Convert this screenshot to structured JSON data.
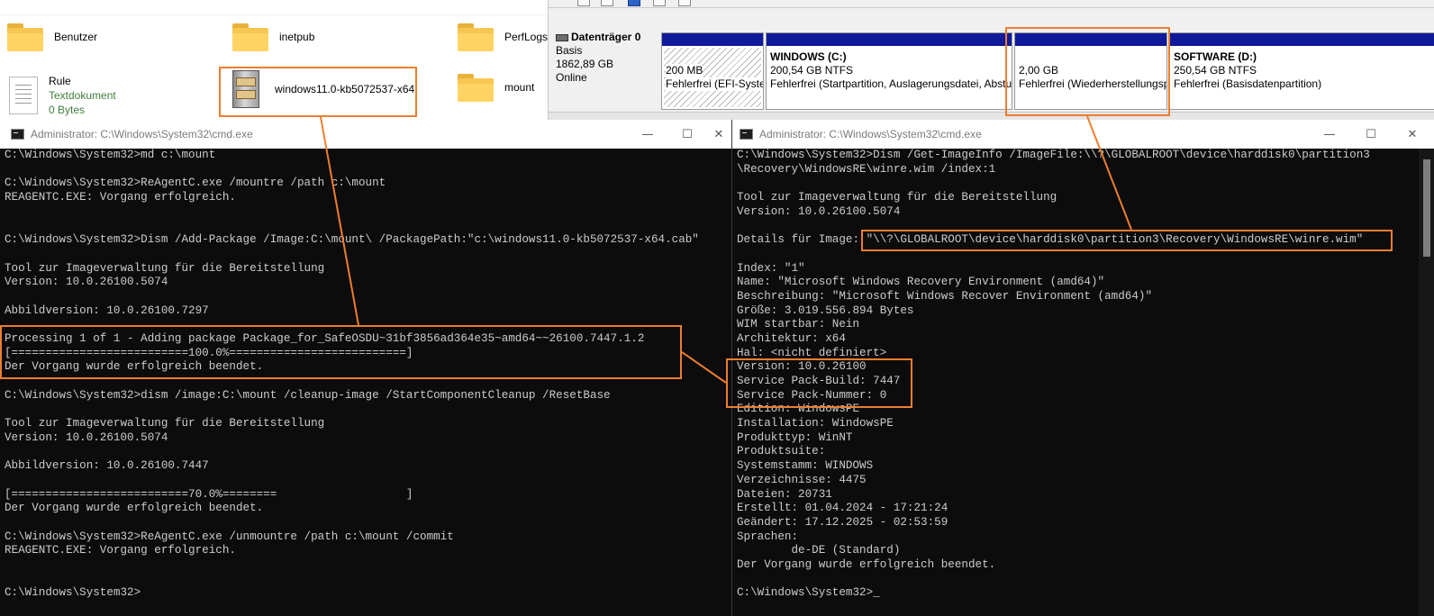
{
  "explorer": {
    "items": [
      {
        "name": "Benutzer",
        "kind": "folder"
      },
      {
        "name": "inetpub",
        "kind": "folder"
      },
      {
        "name": "PerfLogs",
        "kind": "folder"
      },
      {
        "name": "Rule",
        "kind": "text",
        "type": "Textdokument",
        "size": "0 Bytes"
      },
      {
        "name": "windows11.0-kb5072537-x64",
        "kind": "cab"
      },
      {
        "name": "mount",
        "kind": "folder"
      }
    ]
  },
  "disk_mgmt": {
    "disk": {
      "title": "Datenträger 0",
      "type": "Basis",
      "size": "1862,89 GB",
      "status": "Online"
    },
    "partitions": [
      {
        "name": "",
        "size": "200 MB",
        "status": "Fehlerfrei (EFI-Systempartition)"
      },
      {
        "name": "WINDOWS  (C:)",
        "size": "200,54 GB NTFS",
        "status": "Fehlerfrei (Startpartition, Auslagerungsdatei, Absturzabbild, Primäre Partition)"
      },
      {
        "name": "",
        "size": "2,00 GB",
        "status": "Fehlerfrei (Wiederherstellungspartition)"
      },
      {
        "name": "SOFTWARE  (D:)",
        "size": "250,54 GB NTFS",
        "status": "Fehlerfrei (Basisdatenpartition)"
      }
    ]
  },
  "cmd_left": {
    "title": "Administrator: C:\\Windows\\System32\\cmd.exe",
    "lines": [
      "C:\\Windows\\System32>md c:\\mount",
      "",
      "C:\\Windows\\System32>ReAgentC.exe /mountre /path c:\\mount",
      "REAGENTC.EXE: Vorgang erfolgreich.",
      "",
      "",
      "C:\\Windows\\System32>Dism /Add-Package /Image:C:\\mount\\ /PackagePath:\"c:\\windows11.0-kb5072537-x64.cab\"",
      "",
      "Tool zur Imageverwaltung für die Bereitstellung",
      "Version: 10.0.26100.5074",
      "",
      "Abbildversion: 10.0.26100.7297",
      "",
      "Processing 1 of 1 - Adding package Package_for_SafeOSDU~31bf3856ad364e35~amd64~~26100.7447.1.2",
      "[==========================100.0%==========================]",
      "Der Vorgang wurde erfolgreich beendet.",
      "",
      "C:\\Windows\\System32>dism /image:C:\\mount /cleanup-image /StartComponentCleanup /ResetBase",
      "",
      "Tool zur Imageverwaltung für die Bereitstellung",
      "Version: 10.0.26100.5074",
      "",
      "Abbildversion: 10.0.26100.7447",
      "",
      "[==========================70.0%========                   ]",
      "Der Vorgang wurde erfolgreich beendet.",
      "",
      "C:\\Windows\\System32>ReAgentC.exe /unmountre /path c:\\mount /commit",
      "REAGENTC.EXE: Vorgang erfolgreich.",
      "",
      "",
      "C:\\Windows\\System32>"
    ]
  },
  "cmd_right": {
    "title": "Administrator: C:\\Windows\\System32\\cmd.exe",
    "lines": [
      "C:\\Windows\\System32>Dism /Get-ImageInfo /ImageFile:\\\\?\\GLOBALROOT\\device\\harddisk0\\partition3",
      "\\Recovery\\WindowsRE\\winre.wim /index:1",
      "",
      "Tool zur Imageverwaltung für die Bereitstellung",
      "Version: 10.0.26100.5074",
      "",
      "Details für Image: \"\\\\?\\GLOBALROOT\\device\\harddisk0\\partition3\\Recovery\\WindowsRE\\winre.wim\"",
      "",
      "Index: \"1\"",
      "Name: \"Microsoft Windows Recovery Environment (amd64)\"",
      "Beschreibung: \"Microsoft Windows Recover Environment (amd64)\"",
      "Größe: 3.019.556.894 Bytes",
      "WIM startbar: Nein",
      "Architektur: x64",
      "Hal: <nicht definiert>",
      "Version: 10.0.26100",
      "Service Pack-Build: 7447",
      "Service Pack-Nummer: 0",
      "Edition: WindowsPE",
      "Installation: WindowsPE",
      "Produkttyp: WinNT",
      "Produktsuite:",
      "Systemstamm: WINDOWS",
      "Verzeichnisse: 4475",
      "Dateien: 20731",
      "Erstellt: 01.04.2024 - 17:21:24",
      "Geändert: 17.12.2025 - 02:53:59",
      "Sprachen:",
      "        de-DE (Standard)",
      "Der Vorgang wurde erfolgreich beendet.",
      "",
      "C:\\Windows\\System32>_"
    ]
  },
  "colors": {
    "highlight": "#ee7d2e",
    "console_bg": "#0c0c0c",
    "console_fg": "#cccccc",
    "partition_bar": "#0e1a9a"
  }
}
